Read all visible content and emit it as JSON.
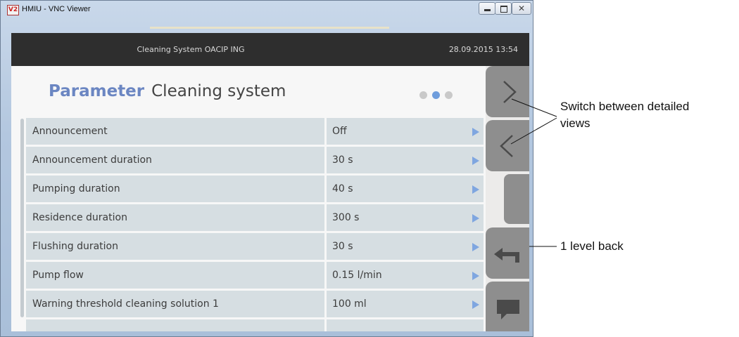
{
  "window": {
    "title": "HMIU - VNC Viewer",
    "icon_text": "V2"
  },
  "header": {
    "system_title": "Cleaning System  OACIP ING",
    "datetime": "28.09.2015  13:54"
  },
  "page": {
    "heading_highlight": "Parameter",
    "heading_rest": "Cleaning system",
    "page_dots_total": 3,
    "page_dots_active": 2
  },
  "parameters": [
    {
      "label": "Announcement",
      "value": "Off"
    },
    {
      "label": "Announcement duration",
      "value": "30 s"
    },
    {
      "label": "Pumping duration",
      "value": "40 s"
    },
    {
      "label": "Residence duration",
      "value": "300 s"
    },
    {
      "label": "Flushing duration",
      "value": "30 s"
    },
    {
      "label": "Pump flow",
      "value": "0.15 l/min"
    },
    {
      "label": "Warning threshold cleaning solution 1",
      "value": "100 ml"
    }
  ],
  "nav_buttons": [
    "chevron-right-icon",
    "chevron-left-icon",
    "blank",
    "back-arrow-icon",
    "chat-bubble-icon"
  ],
  "annotations": {
    "switch_line1": "Switch between detailed",
    "switch_line2": "views",
    "back": "1 level back"
  },
  "colors": {
    "header_bg": "#2e2e2e",
    "row_bg": "#d6dee2",
    "accent_blue": "#6b86c2",
    "arrow_blue": "#7fa6e0",
    "nav_button": "#8e8e8e"
  }
}
